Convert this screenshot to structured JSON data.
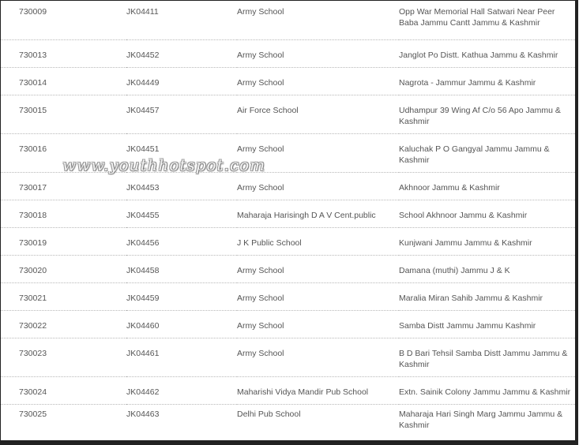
{
  "rows": [
    {
      "code": "730009",
      "id": "JK04411",
      "school": "Army School",
      "address": "Opp War Memorial Hall Satwari Near Peer Baba Jammu Cantt Jammu & Kashmir"
    },
    {
      "code": "730013",
      "id": "JK04452",
      "school": "Army School",
      "address": "Janglot Po Distt. Kathua Jammu & Kashmir"
    },
    {
      "code": "730014",
      "id": "JK04449",
      "school": "Army School",
      "address": "Nagrota - Jammur Jammu & Kashmir"
    },
    {
      "code": "730015",
      "id": "JK04457",
      "school": "Air Force School",
      "address": "Udhampur 39 Wing Af C/o 56 Apo Jammu & Kashmir"
    },
    {
      "code": "730016",
      "id": "JK04451",
      "school": "Army School",
      "address": "Kaluchak P O Gangyal Jammu Jammu & Kashmir"
    },
    {
      "code": "730017",
      "id": "JK04453",
      "school": "Army School",
      "address": "Akhnoor Jammu & Kashmir"
    },
    {
      "code": "730018",
      "id": "JK04455",
      "school": "Maharaja Harisingh D A V Cent.public",
      "address": "School Akhnoor Jammu & Kashmir"
    },
    {
      "code": "730019",
      "id": "JK04456",
      "school": "J K Public School",
      "address": "Kunjwani Jammu Jammu & Kashmir"
    },
    {
      "code": "730020",
      "id": "JK04458",
      "school": "Army School",
      "address": "Damana (muthi) Jammu J & K"
    },
    {
      "code": "730021",
      "id": "JK04459",
      "school": "Army School",
      "address": "Maralia Miran Sahib Jammu & Kashmir"
    },
    {
      "code": "730022",
      "id": "JK04460",
      "school": "Army School",
      "address": "Samba Distt Jammu Jammu Kashmir"
    },
    {
      "code": "730023",
      "id": "JK04461",
      "school": "Army School",
      "address": "B D Bari Tehsil Samba Distt Jammu Jammu & Kashmir"
    },
    {
      "code": "730024",
      "id": "JK04462",
      "school": "Maharishi Vidya Mandir Pub School",
      "address": "Extn. Sainik Colony Jammu Jammu & Kashmir"
    },
    {
      "code": "730025",
      "id": "JK04463",
      "school": "Delhi Pub School",
      "address": "Maharaja Hari Singh Marg Jammu Jammu & Kashmir"
    }
  ],
  "watermark": "www.youthhotspot.com"
}
